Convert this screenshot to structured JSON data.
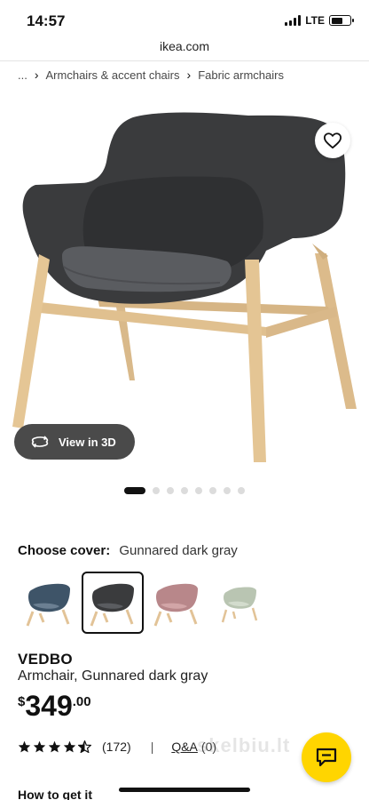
{
  "status": {
    "time": "14:57",
    "network": "LTE",
    "battery_level": 0.6
  },
  "browser": {
    "url": "ikea.com"
  },
  "breadcrumb": {
    "ellipsis": "...",
    "items": [
      "Armchairs & accent chairs",
      "Fabric armchairs"
    ]
  },
  "gallery": {
    "view3d_label": "View in 3D",
    "image_count": 9,
    "active_index": 0
  },
  "cover": {
    "label": "Choose cover:",
    "selected": "Gunnared dark gray",
    "swatches": [
      {
        "name": "blue",
        "color": "#3e5468"
      },
      {
        "name": "dark-gray",
        "color": "#3a3b3d",
        "selected": true
      },
      {
        "name": "pink",
        "color": "#b8878a"
      },
      {
        "name": "light-green",
        "color": "#b9c5b2"
      }
    ]
  },
  "product": {
    "name": "VEDBO",
    "description": "Armchair, Gunnared dark gray",
    "price": {
      "currency": "$",
      "integer": "349",
      "decimal": ".00"
    }
  },
  "reviews": {
    "rating": 4.5,
    "count": "(172)",
    "separator": "|",
    "qa_label": "Q&A",
    "qa_count": "(0)"
  },
  "watermark": "skelbiu.lt",
  "section": {
    "how_to_get_it": "How to get it"
  },
  "colors": {
    "accent_yellow": "#ffd500",
    "chair_fabric": "#3a3b3d",
    "wood": "#e2c397"
  }
}
